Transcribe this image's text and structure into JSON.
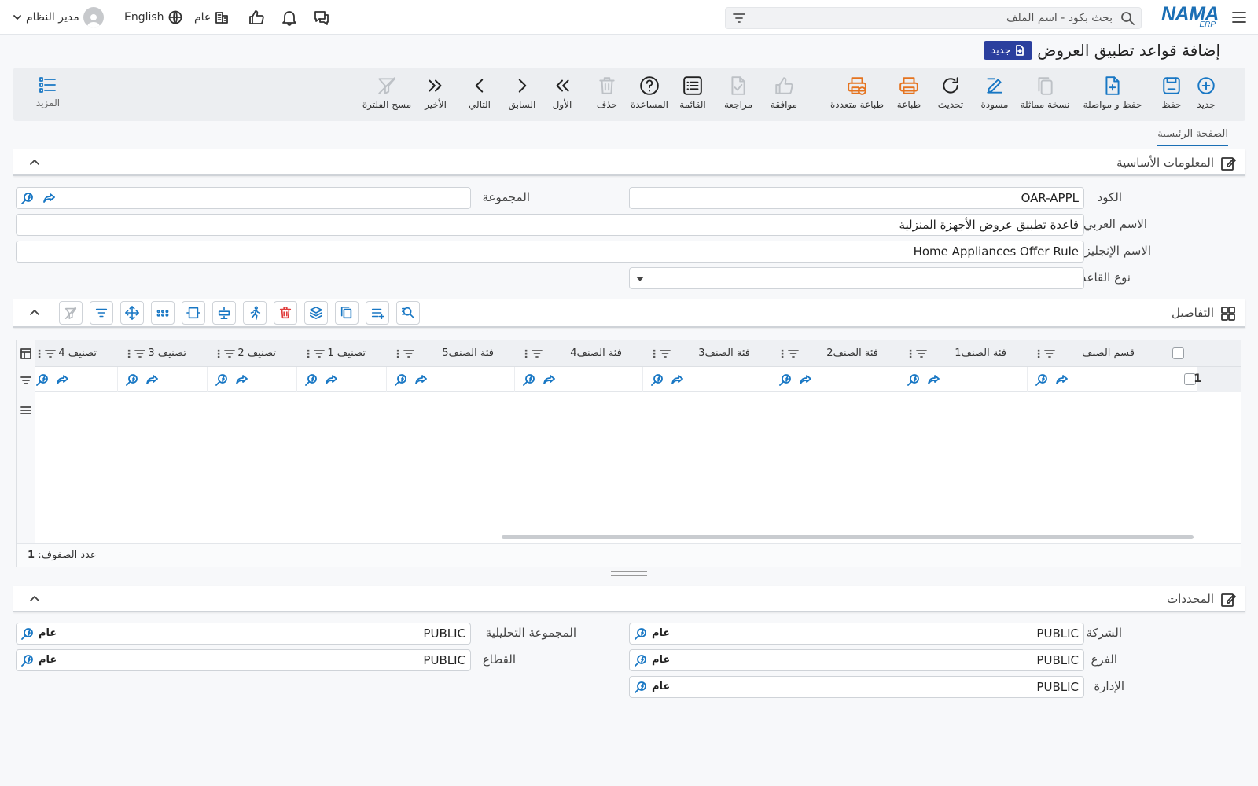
{
  "header": {
    "logo_main": "NAMA",
    "logo_sub": "ERP",
    "search_placeholder": "بحث بكود - اسم الملف",
    "language": "English",
    "scope": "عام",
    "user": "مدير النظام"
  },
  "page": {
    "title": "إضافة قواعد تطبيق العروض",
    "badge": "جديد"
  },
  "toolbar": [
    {
      "label": "جديد",
      "icon": "plus-circle-icon",
      "color": "blue"
    },
    {
      "label": "حفظ",
      "icon": "save-icon",
      "color": "blue"
    },
    {
      "label": "حفظ و مواصلة",
      "icon": "file-plus-icon",
      "color": "blue"
    },
    {
      "label": "نسخة مماثلة",
      "icon": "copy-icon",
      "color": "gray"
    },
    {
      "label": "مسودة",
      "icon": "edit-draft-icon",
      "color": "blue"
    },
    {
      "label": "تحديث",
      "icon": "refresh-icon",
      "color": "dark"
    },
    {
      "label": "طباعة",
      "icon": "printer-icon",
      "color": "orange"
    },
    {
      "label": "طباعة متعددة",
      "icon": "multi-printer-icon",
      "color": "orange"
    },
    {
      "label": "موافقة",
      "icon": "thumbs-up-icon",
      "color": "gray"
    },
    {
      "label": "مراجعة",
      "icon": "file-check-icon",
      "color": "gray"
    },
    {
      "label": "القائمة",
      "icon": "list-icon",
      "color": "dark"
    },
    {
      "label": "المساعدة",
      "icon": "help-icon",
      "color": "dark"
    },
    {
      "label": "حذف",
      "icon": "trash-icon",
      "color": "gray"
    },
    {
      "label": "الأول",
      "icon": "first-icon",
      "color": "dark"
    },
    {
      "label": "السابق",
      "icon": "prev-icon",
      "color": "dark"
    },
    {
      "label": "التالي",
      "icon": "next-icon",
      "color": "dark"
    },
    {
      "label": "الأخير",
      "icon": "last-icon",
      "color": "dark"
    },
    {
      "label": "مسح الفلترة",
      "icon": "clear-filter-icon",
      "color": "gray"
    }
  ],
  "more_label": "المزيد",
  "tab_main": "الصفحة الرئيسية",
  "basic": {
    "title": "المعلومات الأساسية",
    "code_label": "الكود",
    "code_value": "OAR-APPL",
    "group_label": "المجموعة",
    "group_value": "",
    "arabic_name_label": "الاسم العربي",
    "arabic_name_value": "قاعدة تطبيق عروض الأجهزة المنزلية",
    "english_name_label": "الاسم الإنجليزي",
    "english_name_value": "Home Appliances Offer Rule",
    "rule_type_label": "نوع القاعدة",
    "rule_type_value": ""
  },
  "details": {
    "title": "التفاصيل",
    "columns": [
      "قسم الصنف",
      "فئة الصنف1",
      "فئة الصنف2",
      "فئة الصنف3",
      "فئة الصنف4",
      "فئة الصنف5",
      "تصنيف 1",
      "تصنيف 2",
      "تصنيف 3",
      "تصنيف 4"
    ],
    "rows": [
      "1"
    ],
    "row_count_label": "عدد الصفوف:",
    "row_count": "1"
  },
  "dimensions": {
    "title": "المحددات",
    "tag": "عام",
    "company_label": "الشركة",
    "company_value": "PUBLIC",
    "branch_label": "الفرع",
    "branch_value": "PUBLIC",
    "department_label": "الإدارة",
    "department_value": "PUBLIC",
    "analytic_group_label": "المجموعة التحليلية",
    "analytic_group_value": "PUBLIC",
    "sector_label": "القطاع",
    "sector_value": "PUBLIC"
  }
}
